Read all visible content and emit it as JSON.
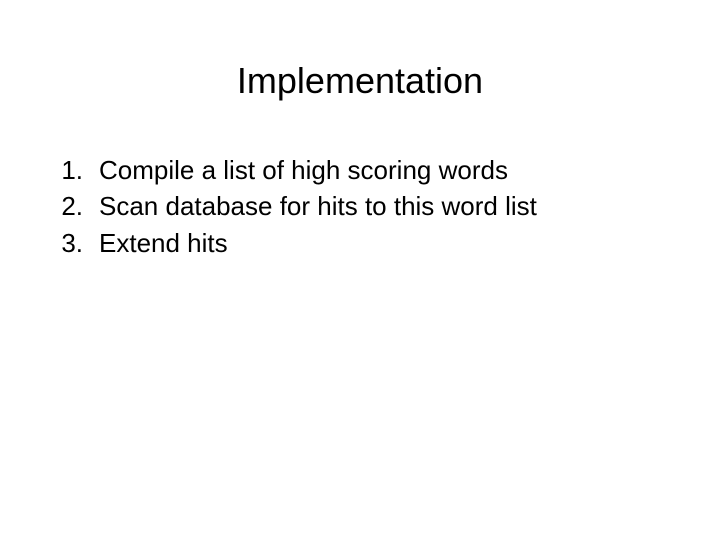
{
  "slide": {
    "title": "Implementation",
    "items": [
      {
        "number": "1.",
        "text": "Compile a list of high scoring words"
      },
      {
        "number": "2.",
        "text": "Scan database for hits to this word list"
      },
      {
        "number": "3.",
        "text": "Extend hits"
      }
    ]
  }
}
